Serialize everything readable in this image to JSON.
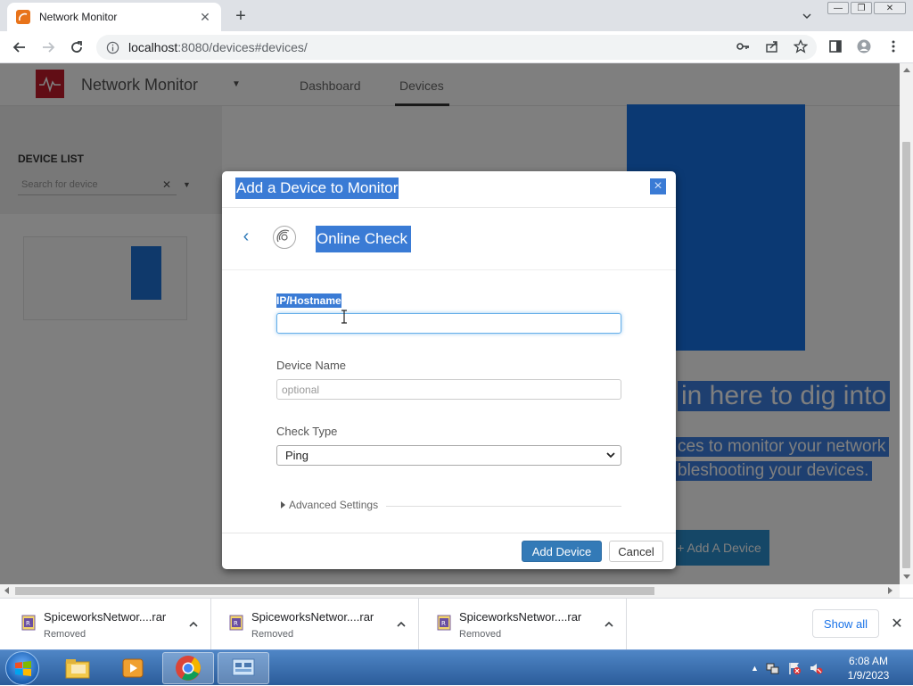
{
  "browser": {
    "tab_title": "Network Monitor",
    "url_host": "localhost",
    "url_rest": ":8080/devices#devices/"
  },
  "app": {
    "name": "Network Monitor",
    "nav": [
      "Dashboard",
      "Devices"
    ],
    "sidebar_title": "DEVICE LIST",
    "search_placeholder": "Search for device",
    "hero_title": "in here to dig into",
    "hero_line1": "ces to monitor your network",
    "hero_line2": "bleshooting your devices.",
    "hero_button": "+ Add A Device"
  },
  "modal": {
    "title": "Add a Device to Monitor",
    "close": "×",
    "step_title": "Online Check",
    "ip_label": "IP/Hostname",
    "ip_value": "",
    "name_label": "Device Name",
    "name_placeholder": "optional",
    "check_label": "Check Type",
    "check_value": "Ping",
    "advanced": "Advanced Settings",
    "add_button": "Add Device",
    "cancel_button": "Cancel"
  },
  "downloads": [
    {
      "name": "SpiceworksNetwor....rar",
      "status": "Removed"
    },
    {
      "name": "SpiceworksNetwor....rar",
      "status": "Removed"
    },
    {
      "name": "SpiceworksNetwor....rar",
      "status": "Removed"
    }
  ],
  "show_all": "Show all",
  "taskbar": {
    "time": "6:08 AM",
    "date": "1/9/2023"
  },
  "colors": {
    "selection": "#3a7bd5",
    "primary_button": "#337ab7",
    "logo": "#c21b2b"
  }
}
